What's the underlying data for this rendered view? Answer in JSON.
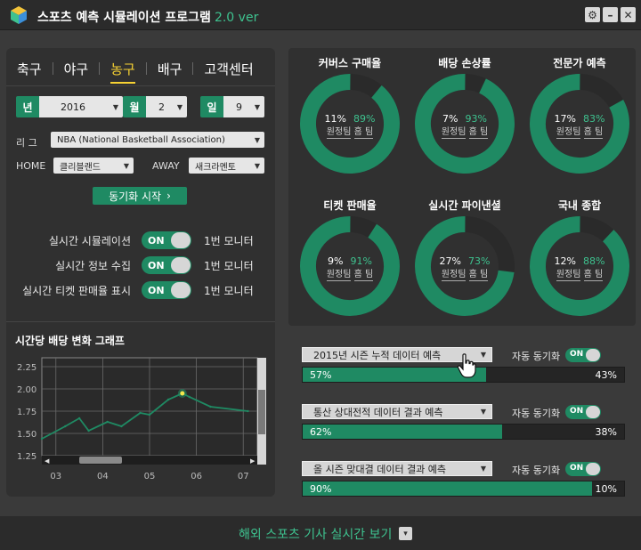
{
  "window": {
    "title": "스포츠 예측 시뮬레이션 프로그램",
    "version": "2.0 ver",
    "buttons": {
      "settings": "⚙",
      "minimize": "–",
      "close": "✕"
    }
  },
  "sport_tabs": [
    "축구",
    "야구",
    "농구",
    "배구",
    "고객센터"
  ],
  "active_tab": "농구",
  "date": {
    "year_label": "년",
    "year": "2016",
    "month_label": "월",
    "month": "2",
    "day_label": "일",
    "day": "9"
  },
  "league": {
    "label": "리 그",
    "value": "NBA (National Basketball Association)"
  },
  "teams": {
    "home_label": "HOME",
    "home": "클리블랜드",
    "away_label": "AWAY",
    "away": "새크라멘토"
  },
  "sync_button": "동기화 시작",
  "toggles": [
    {
      "label": "실시간 시뮬레이션",
      "state": "ON",
      "monitor": "1번 모니터"
    },
    {
      "label": "실시간 정보 수집",
      "state": "ON",
      "monitor": "1번 모니터"
    },
    {
      "label": "실시간 티켓 판매율 표시",
      "state": "ON",
      "monitor": "1번 모니터"
    }
  ],
  "chart_data": {
    "type": "line",
    "title": "시간당 배당 변화 그래프",
    "x_ticks": [
      "03",
      "04",
      "05",
      "06",
      "07"
    ],
    "y_ticks": [
      "2.25",
      "2.00",
      "1.75",
      "1.50",
      "1.25"
    ],
    "ylim": [
      1.25,
      2.35
    ],
    "x": [
      2.7,
      3.2,
      3.5,
      3.7,
      4.1,
      4.4,
      4.8,
      5.0,
      5.4,
      5.7,
      5.85,
      6.3,
      7.1
    ],
    "y": [
      1.44,
      1.58,
      1.67,
      1.53,
      1.63,
      1.58,
      1.73,
      1.71,
      1.88,
      1.95,
      1.91,
      1.8,
      1.75
    ],
    "highlight_index": 9,
    "line_color": "#1f8a63",
    "grid": true
  },
  "donuts": [
    {
      "title": "커버스 구매율",
      "away_pct": "11%",
      "home_pct": "89%",
      "home_value": 89
    },
    {
      "title": "배당 손상률",
      "away_pct": "7%",
      "home_pct": "93%",
      "home_value": 93
    },
    {
      "title": "전문가 예측",
      "away_pct": "17%",
      "home_pct": "83%",
      "home_value": 83
    },
    {
      "title": "티켓 판매율",
      "away_pct": "9%",
      "home_pct": "91%",
      "home_value": 91
    },
    {
      "title": "실시간 파이낸셜",
      "away_pct": "27%",
      "home_pct": "73%",
      "home_value": 73
    },
    {
      "title": "국내 종합",
      "away_pct": "12%",
      "home_pct": "88%",
      "home_value": 88
    }
  ],
  "donut_labels": {
    "away": "원정팀",
    "home": "홈 팀"
  },
  "predictions": [
    {
      "label": "2015년 시즌 누적 데이터 예측",
      "auto_label": "자동 동기화",
      "toggle": "ON",
      "left_pct": "57%",
      "right_pct": "43%",
      "fill": 0.57
    },
    {
      "label": "통산 상대전적 데이터 결과 예측",
      "auto_label": "자동 동기화",
      "toggle": "ON",
      "left_pct": "62%",
      "right_pct": "38%",
      "fill": 0.62
    },
    {
      "label": "올 시즌 맞대결 데이터 결과 예측",
      "auto_label": "자동 동기화",
      "toggle": "ON",
      "left_pct": "90%",
      "right_pct": "10%",
      "fill": 0.9
    }
  ],
  "footer": {
    "text": "해외 스포츠 기사 실시간 보기",
    "button": "▾"
  },
  "colors": {
    "accent": "#1f8a63",
    "accent_text": "#3ec28f",
    "tab_active": "#f7d233",
    "donut_away": "#2a2a2a"
  }
}
